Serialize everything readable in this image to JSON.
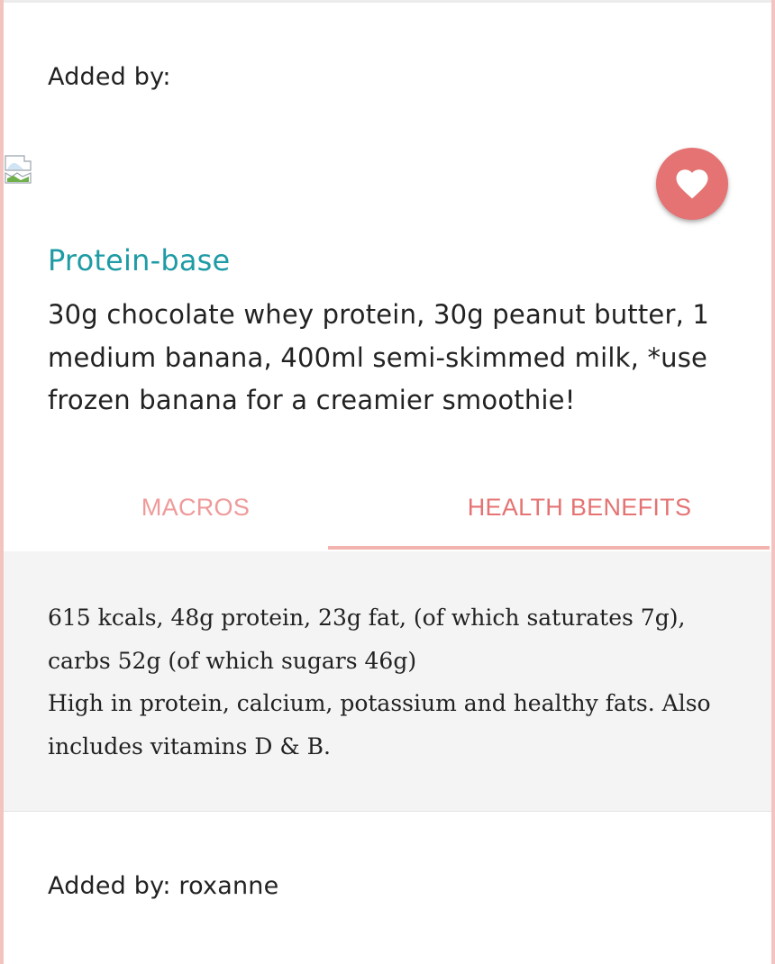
{
  "card_top": {
    "added_by_label": "Added by:"
  },
  "recipe": {
    "image_icon": "broken-image-icon",
    "favorite_icon": "heart-icon",
    "title": "Protein-base",
    "description": "30g chocolate whey protein, 30g peanut butter, 1 medium banana, 400ml semi-skimmed milk, *use frozen banana for a creamier smoothie!"
  },
  "tabs": [
    {
      "label": "MACROS",
      "active": false
    },
    {
      "label": "HEALTH BENEFITS",
      "active": true
    }
  ],
  "panel": {
    "macros_text": "615 kcals, 48g protein, 23g fat, (of which saturates 7g), carbs 52g (of which sugars 46g)",
    "health_text": "High in protein, calcium, potassium and healthy fats. Also includes vitamins D & B."
  },
  "card_bottom": {
    "added_by_text": "Added by: roxanne"
  },
  "colors": {
    "accent_teal": "#1e9ba5",
    "accent_coral": "#e57373",
    "tab_inactive": "#ef9a9a",
    "panel_bg": "#f4f4f4",
    "edge": "#f3c4bf"
  }
}
